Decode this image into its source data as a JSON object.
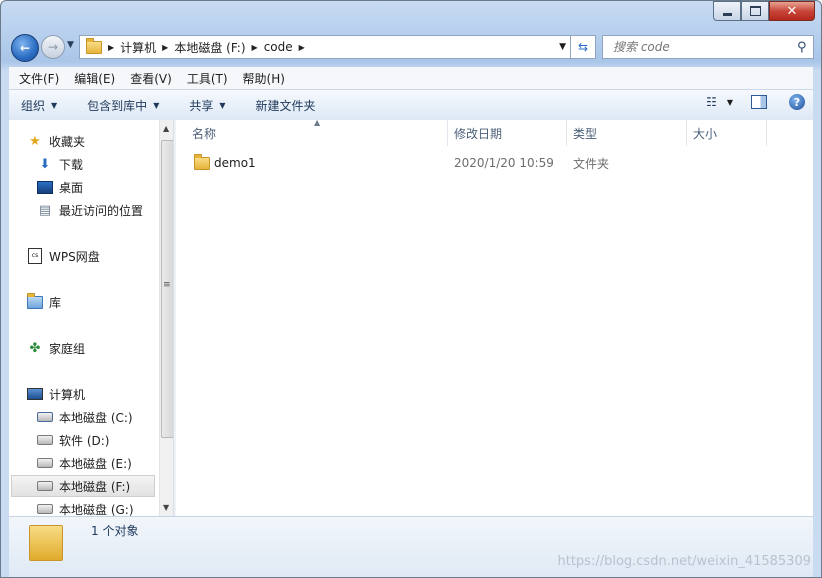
{
  "window": {
    "minimize_icon": "minimize-icon",
    "maximize_icon": "maximize-icon",
    "close_icon": "close-icon"
  },
  "address": {
    "crumbs": [
      "计算机",
      "本地磁盘 (F:)",
      "code"
    ]
  },
  "search": {
    "placeholder": "搜索 code"
  },
  "menu": [
    "文件(F)",
    "编辑(E)",
    "查看(V)",
    "工具(T)",
    "帮助(H)"
  ],
  "commands": {
    "organize": "组织",
    "include_in_library": "包含到库中",
    "share": "共享",
    "new_folder": "新建文件夹"
  },
  "nav": {
    "favorites": "收藏夹",
    "downloads": "下载",
    "desktop": "桌面",
    "recent": "最近访问的位置",
    "wps": "WPS网盘",
    "libraries": "库",
    "homegroup": "家庭组",
    "computer": "计算机",
    "drives": [
      "本地磁盘 (C:)",
      "软件 (D:)",
      "本地磁盘 (E:)",
      "本地磁盘 (F:)",
      "本地磁盘 (G:)"
    ]
  },
  "columns": {
    "name": "名称",
    "modified": "修改日期",
    "type": "类型",
    "size": "大小"
  },
  "files": [
    {
      "name": "demo1",
      "modified": "2020/1/20 10:59",
      "type": "文件夹",
      "size": ""
    }
  ],
  "status": {
    "count": "1 个对象"
  },
  "watermark": "https://blog.csdn.net/weixin_41585309",
  "colors": {
    "accent": "#2a6cc2",
    "frame": "#b9d1ee",
    "selected": "#e2e2e2"
  }
}
